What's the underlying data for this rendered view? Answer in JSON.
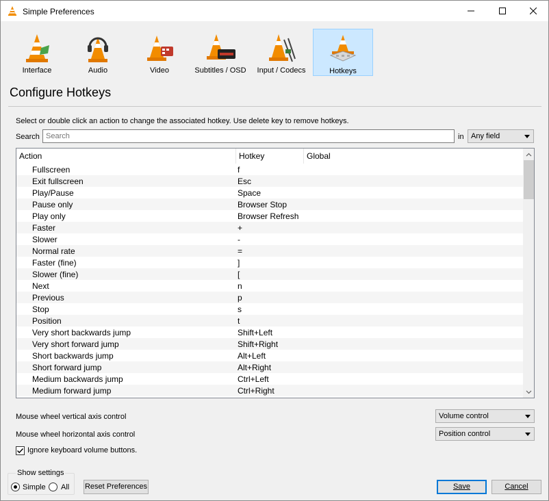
{
  "window": {
    "title": "Simple Preferences",
    "icon": "vlc-cone-icon",
    "controls": [
      "minimize-icon",
      "maximize-icon",
      "close-icon"
    ]
  },
  "categories": [
    {
      "label": "Interface",
      "icon": "vlc-interface-icon",
      "selected": false
    },
    {
      "label": "Audio",
      "icon": "vlc-audio-headphones-icon",
      "selected": false
    },
    {
      "label": "Video",
      "icon": "vlc-video-film-icon",
      "selected": false
    },
    {
      "label": "Subtitles / OSD",
      "icon": "vlc-subtitles-icon",
      "selected": false
    },
    {
      "label": "Input / Codecs",
      "icon": "vlc-codecs-icon",
      "selected": false
    },
    {
      "label": "Hotkeys",
      "icon": "vlc-hotkeys-icon",
      "selected": true
    }
  ],
  "section": {
    "title": "Configure Hotkeys",
    "hint": "Select or double click an action to change the associated hotkey. Use delete key to remove hotkeys.",
    "search_label": "Search",
    "search_placeholder": "Search",
    "in_label": "in",
    "field_select": "Any field"
  },
  "table": {
    "headers": [
      "Action",
      "Hotkey",
      "Global"
    ],
    "rows": [
      {
        "action": "Fullscreen",
        "hotkey": "f",
        "global": ""
      },
      {
        "action": "Exit fullscreen",
        "hotkey": "Esc",
        "global": ""
      },
      {
        "action": "Play/Pause",
        "hotkey": "Space",
        "global": ""
      },
      {
        "action": "Pause only",
        "hotkey": "Browser Stop",
        "global": ""
      },
      {
        "action": "Play only",
        "hotkey": "Browser Refresh",
        "global": ""
      },
      {
        "action": "Faster",
        "hotkey": "+",
        "global": ""
      },
      {
        "action": "Slower",
        "hotkey": "-",
        "global": ""
      },
      {
        "action": "Normal rate",
        "hotkey": "=",
        "global": ""
      },
      {
        "action": "Faster (fine)",
        "hotkey": "]",
        "global": ""
      },
      {
        "action": "Slower (fine)",
        "hotkey": "[",
        "global": ""
      },
      {
        "action": "Next",
        "hotkey": "n",
        "global": ""
      },
      {
        "action": "Previous",
        "hotkey": "p",
        "global": ""
      },
      {
        "action": "Stop",
        "hotkey": "s",
        "global": ""
      },
      {
        "action": "Position",
        "hotkey": "t",
        "global": ""
      },
      {
        "action": "Very short backwards jump",
        "hotkey": "Shift+Left",
        "global": ""
      },
      {
        "action": "Very short forward jump",
        "hotkey": "Shift+Right",
        "global": ""
      },
      {
        "action": "Short backwards jump",
        "hotkey": "Alt+Left",
        "global": ""
      },
      {
        "action": "Short forward jump",
        "hotkey": "Alt+Right",
        "global": ""
      },
      {
        "action": "Medium backwards jump",
        "hotkey": "Ctrl+Left",
        "global": ""
      },
      {
        "action": "Medium forward jump",
        "hotkey": "Ctrl+Right",
        "global": ""
      }
    ]
  },
  "mouse": {
    "vertical_label": "Mouse wheel vertical axis control",
    "vertical_value": "Volume control",
    "horizontal_label": "Mouse wheel horizontal axis control",
    "horizontal_value": "Position control"
  },
  "ignore_volume": {
    "label": "Ignore keyboard volume buttons.",
    "checked": true
  },
  "show_settings": {
    "title": "Show settings",
    "simple": "Simple",
    "all": "All",
    "selected": "Simple"
  },
  "buttons": {
    "reset": "Reset Preferences",
    "save": "Save",
    "cancel": "Cancel"
  }
}
